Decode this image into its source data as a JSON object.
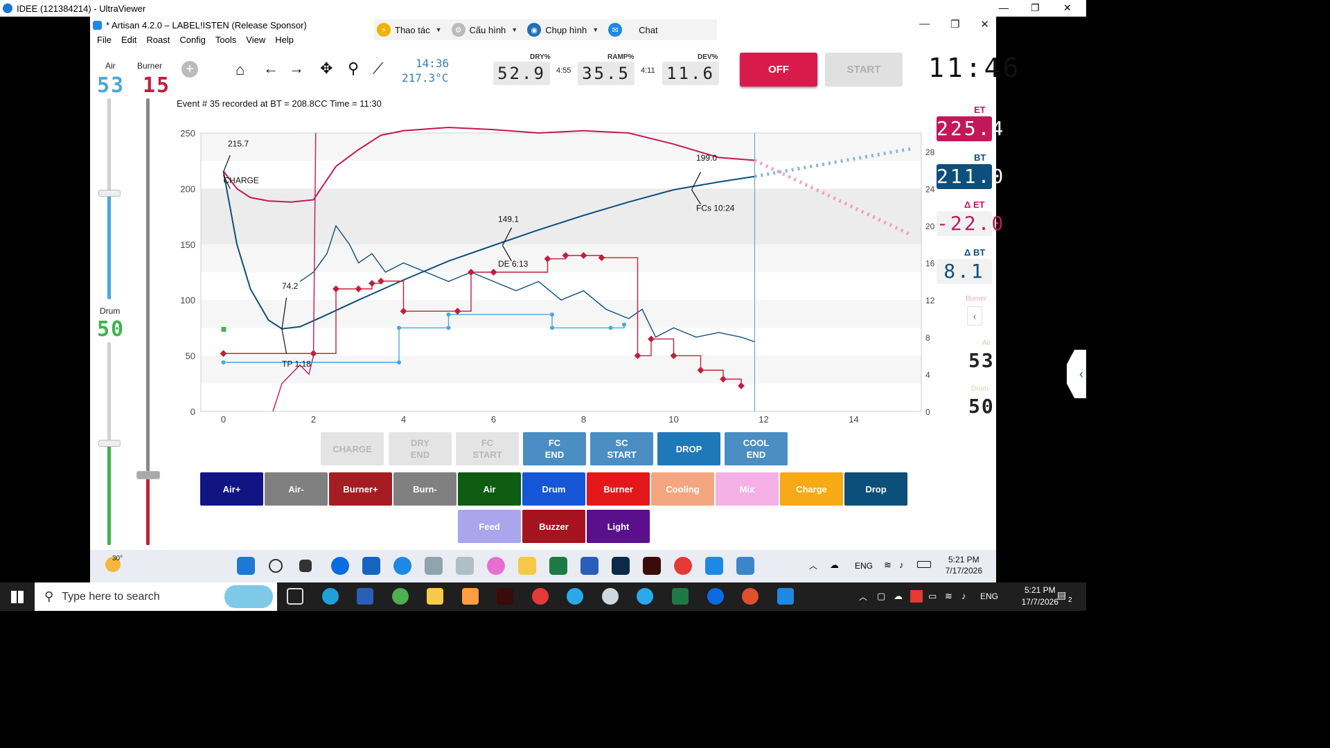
{
  "window": {
    "title": "IDEE (121384214) - UltraViewer",
    "min": "—",
    "max": "❐",
    "close": "✕"
  },
  "app": {
    "title": "* Artisan 4.2.0 – LABEL!ISTEN (Release Sponsor)",
    "menu": [
      "File",
      "Edit",
      "Roast",
      "Config",
      "Tools",
      "View",
      "Help"
    ],
    "win_min": "—",
    "win_max": "❐",
    "win_close": "✕"
  },
  "uv_toolbar": {
    "items": [
      "Thao tác",
      "Cấu hình",
      "Chụp hình",
      "Chat"
    ]
  },
  "controls": {
    "air_label": "Air",
    "air_value": "53",
    "burner_label": "Burner",
    "burner_value": "15",
    "drum_label": "Drum",
    "drum_value": "50"
  },
  "readouts": {
    "time": "14:36",
    "temp": "217.3°C",
    "dry_label": "DRY%",
    "dry_value": "52.9",
    "dry_time": "4:55",
    "ramp_label": "RAMP%",
    "ramp_value": "35.5",
    "ramp_time": "4:11",
    "dev_label": "DEV%",
    "dev_value": "11.6",
    "off": "OFF",
    "start": "START",
    "clock": "11:46"
  },
  "event_message": "Event # 35 recorded at BT = 208.8CC Time = 11:30",
  "right_panel": {
    "et_label": "ET",
    "et_value": "225.4",
    "bt_label": "BT",
    "bt_value": "211.0",
    "det_label": "Δ ET",
    "det_value": "-22.0",
    "dbt_label": "Δ BT",
    "dbt_value": "8.1",
    "burner_faint": "Burner",
    "air_faint": "Air",
    "air_val": "53",
    "drum_faint": "Drum",
    "drum_val": "50"
  },
  "colors": {
    "et": "#c2185b",
    "bt": "#0d4f7c",
    "air": "#4aa8d8",
    "burner": "#c21f3a",
    "drum": "#3cb44b",
    "off": "#d81b4b"
  },
  "chart_data": {
    "type": "line",
    "xlabel": "",
    "ylabel": "",
    "xlim": [
      -0.5,
      15.5
    ],
    "ylim": [
      0,
      250
    ],
    "y2lim": [
      0,
      30
    ],
    "xticks": [
      0,
      2,
      4,
      6,
      8,
      10,
      12,
      14
    ],
    "yticks": [
      0,
      50,
      100,
      150,
      200,
      250
    ],
    "y2ticks": [
      0,
      4,
      8,
      12,
      16,
      20,
      24,
      28
    ],
    "series": [
      {
        "name": "BT",
        "color": "#0d4f7c",
        "x": [
          0,
          0.3,
          0.6,
          1.0,
          1.3,
          1.7,
          2.2,
          3,
          4,
          5,
          6,
          7,
          8,
          9,
          10,
          11,
          11.8
        ],
        "y": [
          215.7,
          150,
          110,
          82,
          74.2,
          76,
          85,
          100,
          118,
          135,
          149.1,
          163,
          176,
          188,
          199,
          206,
          211
        ]
      },
      {
        "name": "ET",
        "color": "#c2185b",
        "x": [
          0,
          0.3,
          0.6,
          1.0,
          1.5,
          2.0,
          2.5,
          3,
          3.5,
          4,
          5,
          6,
          7,
          8,
          9,
          10,
          11,
          11.8
        ],
        "y": [
          215.7,
          200,
          192,
          189,
          188,
          190,
          220,
          235,
          248,
          252,
          255,
          253,
          250,
          252,
          250,
          240,
          228,
          225.4
        ]
      },
      {
        "name": "ΔBT",
        "color": "#0d4f7c",
        "x": [
          1.7,
          2.0,
          2.3,
          2.5,
          2.8,
          3,
          3.3,
          3.6,
          4,
          4.5,
          5,
          5.5,
          6,
          6.5,
          7,
          7.5,
          8,
          8.5,
          9,
          9.3,
          9.6,
          10,
          10.5,
          11,
          11.5,
          11.8
        ],
        "y": [
          14,
          15,
          17,
          20,
          18,
          16,
          17,
          15,
          16,
          15,
          14,
          15,
          14,
          13,
          14,
          12,
          13,
          11,
          10,
          11,
          8,
          9,
          8,
          8.5,
          8,
          7.5
        ]
      },
      {
        "name": "ΔET",
        "color": "#c2185b",
        "x": [
          1.1,
          1.3,
          1.5,
          1.7,
          1.9,
          2.0,
          2.05
        ],
        "y": [
          0,
          3,
          4,
          5,
          4,
          6,
          30
        ]
      },
      {
        "name": "Burner",
        "color": "#c21f3a",
        "x": [
          0,
          2,
          2.5,
          3,
          3.3,
          3.5,
          4,
          5.2,
          5.5,
          6,
          7.2,
          7.6,
          8,
          8.4,
          9.2,
          9.5,
          10,
          10.6,
          11.1,
          11.5
        ],
        "y": [
          52,
          52,
          110,
          110,
          115,
          117,
          90,
          90,
          125,
          125,
          137,
          140,
          140,
          138,
          50,
          65,
          50,
          37,
          29,
          23
        ]
      },
      {
        "name": "Air",
        "color": "#4aa8d8",
        "x": [
          0,
          3.9,
          3.9,
          5,
          5,
          7.3,
          7.3,
          8.6,
          8.9
        ],
        "y": [
          44,
          44,
          75,
          75,
          87,
          87,
          75,
          75,
          78
        ]
      }
    ],
    "annotations": [
      {
        "label": "215.7"
      },
      {
        "label": "CHARGE"
      },
      {
        "label": "74.2"
      },
      {
        "label": "TP 1:18"
      },
      {
        "label": "149.1"
      },
      {
        "label": "DE 6:13"
      },
      {
        "label": "199.0"
      },
      {
        "label": "FCs 10:24"
      }
    ]
  },
  "events": [
    {
      "label": "CHARGE",
      "state": "disabled"
    },
    {
      "label": "DRY\nEND",
      "state": "disabled"
    },
    {
      "label": "FC\nSTART",
      "state": "disabled"
    },
    {
      "label": "FC\nEND",
      "state": "on"
    },
    {
      "label": "SC\nSTART",
      "state": "on"
    },
    {
      "label": "DROP",
      "state": "drop"
    },
    {
      "label": "COOL\nEND",
      "state": "on"
    }
  ],
  "custom_buttons": [
    {
      "label": "Air+",
      "color": "#111584"
    },
    {
      "label": "Air-",
      "color": "#808080"
    },
    {
      "label": "Burner+",
      "color": "#a51d22"
    },
    {
      "label": "Burn-",
      "color": "#808080"
    },
    {
      "label": "Air",
      "color": "#0d5c12"
    },
    {
      "label": "Drum",
      "color": "#1557d6"
    },
    {
      "label": "Burner",
      "color": "#e4171b"
    },
    {
      "label": "Cooling",
      "color": "#f4a680"
    },
    {
      "label": "Mix",
      "color": "#f5b1e6"
    },
    {
      "label": "Charge",
      "color": "#f7a916"
    },
    {
      "label": "Drop",
      "color": "#0b4f7a"
    },
    {
      "label": "Feed",
      "color": "#a9a6ed"
    },
    {
      "label": "Buzzer",
      "color": "#a5141e"
    },
    {
      "label": "Light",
      "color": "#5a108c"
    }
  ],
  "inner_taskbar": {
    "weather": "30°",
    "lang": "ENG",
    "time": "5:21 PM",
    "date": "7/17/2026"
  },
  "taskbar": {
    "search_placeholder": "Type here to search",
    "lang": "ENG",
    "time": "5:21 PM",
    "date": "17/7/2026",
    "notify": "2"
  }
}
